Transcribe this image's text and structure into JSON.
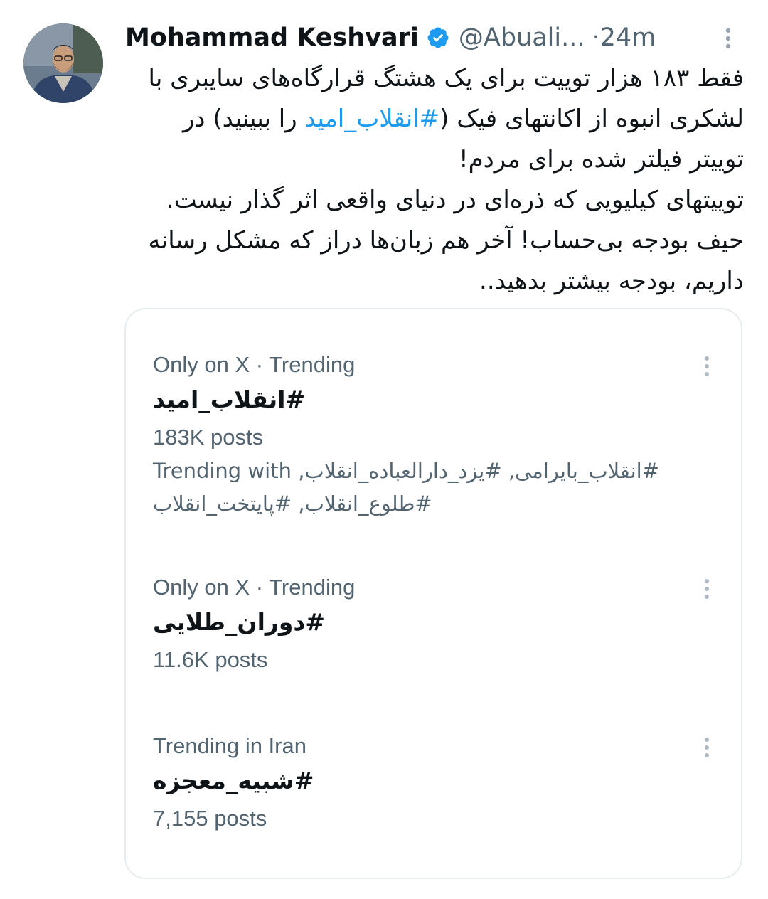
{
  "tweet": {
    "author_name": "Mohammad Keshvari",
    "handle": "@Abuali...",
    "separator": "·",
    "time": "24m",
    "verified_icon": "verified-badge-icon",
    "accent_color": "#1d9bf0",
    "lines": [
      "فقط ۱۸۳ هزار توییت برای یک هشتگ قرارگاه‌های سایبری با",
      "لشکری انبوه از اکانتهای فیک (",
      "#انقلاب_امید",
      " را ببینید) در",
      "توییتر فیلتر شده برای مردم!",
      "توییتهای کیلیویی که ذره‌ای در دنیای واقعی اثر گذار نیست.",
      "حیف بودجه بی‌حساب! آخر هم زبان‌ها دراز که مشکل رسانه",
      "داریم، بودجه بیشتر بدهید.."
    ]
  },
  "trends": [
    {
      "meta": "Only on X · Trending",
      "tag": "#انقلاب_امید",
      "count": "183K posts",
      "with_label": "Trending with",
      "with_line1": "#انقلاب_بایرامی, #یزد_دارالعباده_انقلاب,",
      "with_line2": "#طلوع_انقلاب, #پایتخت_انقلاب"
    },
    {
      "meta": "Only on X · Trending",
      "tag": "#دوران_طلایی",
      "count": "11.6K posts"
    },
    {
      "meta": "Trending in Iran",
      "tag": "#شبیه_معجزه",
      "count": "7,155 posts"
    }
  ]
}
